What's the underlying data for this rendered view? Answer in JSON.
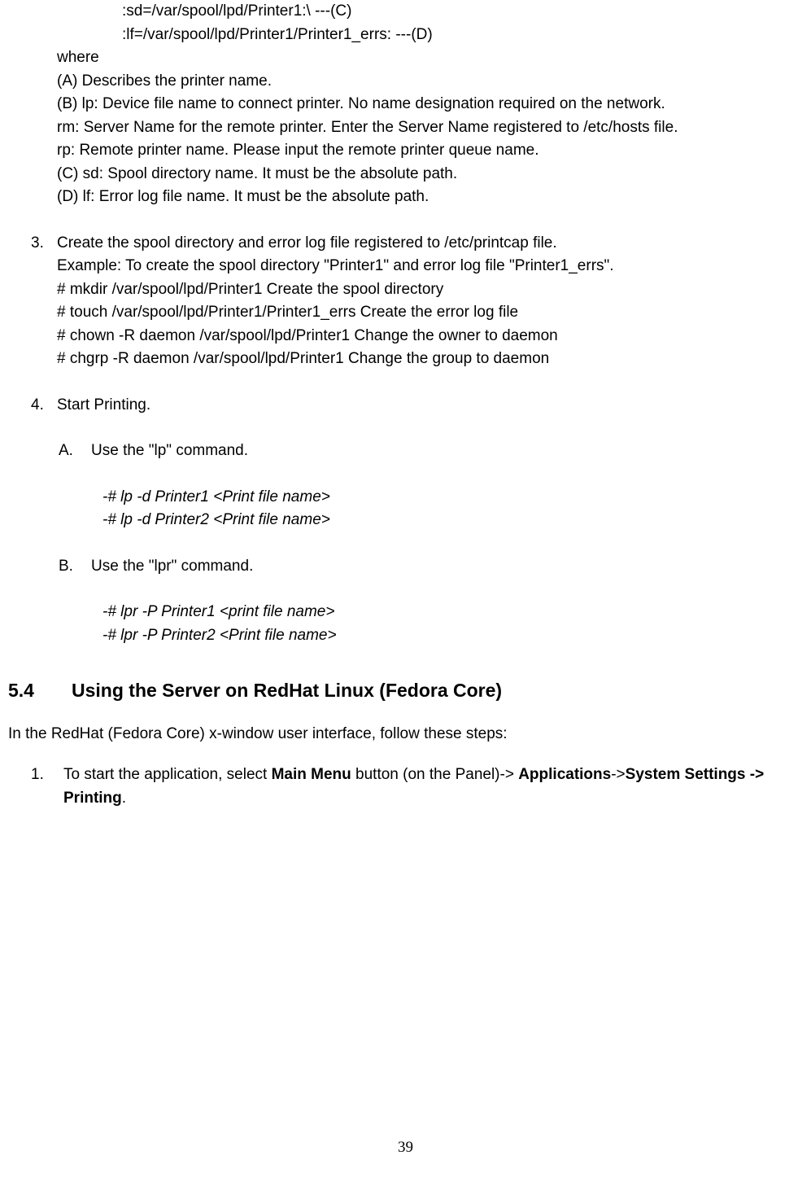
{
  "topLines": {
    "l1": ":sd=/var/spool/lpd/Printer1:\\ ---(C)",
    "l2": ":lf=/var/spool/lpd/Printer1/Printer1_errs: ---(D)"
  },
  "where": "where",
  "desc": {
    "a": "(A) Describes the printer name.",
    "b": "(B) lp: Device file name to connect printer. No name designation required on the network.",
    "rm": "rm: Server Name for the remote printer. Enter the Server Name registered to /etc/hosts file.",
    "rp": "rp: Remote printer name. Please input the remote printer queue name.",
    "c": "(C) sd: Spool directory name. It must be the absolute path.",
    "d": "(D) lf: Error log file name. It must be the absolute path."
  },
  "step3": {
    "num": "3.",
    "l1": "Create the spool directory and error log file registered to /etc/printcap file.",
    "l2": "Example: To create the spool directory \"Printer1\" and error log file \"Printer1_errs\".",
    "cmd1": "# mkdir /var/spool/lpd/Printer1 Create the spool directory",
    "cmd2": "# touch /var/spool/lpd/Printer1/Printer1_errs Create the error log file",
    "cmd3": "# chown -R daemon /var/spool/lpd/Printer1 Change the owner to daemon",
    "cmd4": "# chgrp -R daemon /var/spool/lpd/Printer1 Change the group to daemon"
  },
  "step4": {
    "num": "4.",
    "title": "Start Printing.",
    "a": {
      "letter": "A.",
      "text": "Use the \"lp\" command.",
      "cmd1": "-# lp -d Printer1   <Print file name>",
      "cmd2": "-# lp -d Printer2   <Print file name>"
    },
    "b": {
      "letter": "B.",
      "text": "Use the \"lpr\" command.",
      "cmd1": "-# lpr -P Printer1   <print file name>",
      "cmd2": "-# lpr -P Printer2 <Print file name>"
    }
  },
  "section": {
    "num": "5.4",
    "title": "Using the Server on RedHat Linux (Fedora Core)"
  },
  "intro": "In the RedHat (Fedora Core) x-window user interface, follow these steps:",
  "rh_step1": {
    "num": "1.",
    "p1": "To start the application, select ",
    "b1": "Main Menu",
    "p2": " button (on the Panel)-> ",
    "b2": "Applications",
    "p3": "->",
    "b3": "System Settings -> Printing",
    "p4": "."
  },
  "pageNumber": "39"
}
